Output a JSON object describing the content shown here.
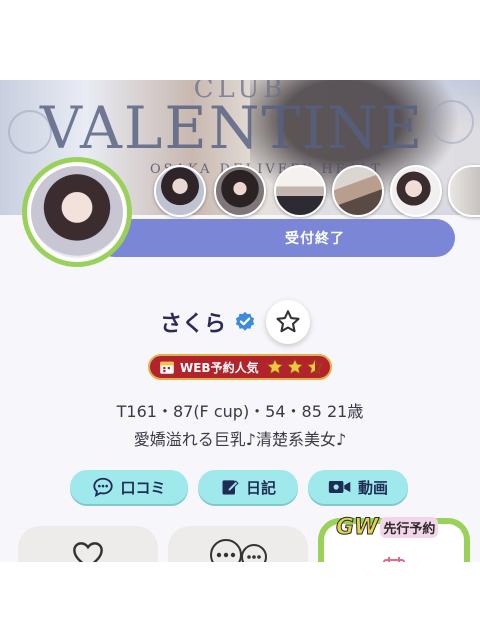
{
  "banner": {
    "club": "CLUB",
    "brand": "VALENTINE",
    "subtitle": "OSAKA DELIVERY HEALT"
  },
  "status": {
    "label": "受付終了"
  },
  "profile": {
    "name": "さくら",
    "stats": "T161・87(F cup)・54・85  21歳",
    "catchphrase": "愛嬌溢れる巨乳♪清楚系美女♪"
  },
  "badge": {
    "label": "WEB予約人気",
    "rating": 2.5,
    "max": 3
  },
  "actions": {
    "review": "口コミ",
    "diary": "日記",
    "video": "動画"
  },
  "promo": {
    "gw": "GW",
    "sub": "先行予約"
  },
  "colors": {
    "accent": "#7b86d6",
    "pill": "#9fe8ec",
    "avatar_ring": "#9ad15a",
    "badge": "#b3232b",
    "verified": "#3d8bdb"
  }
}
